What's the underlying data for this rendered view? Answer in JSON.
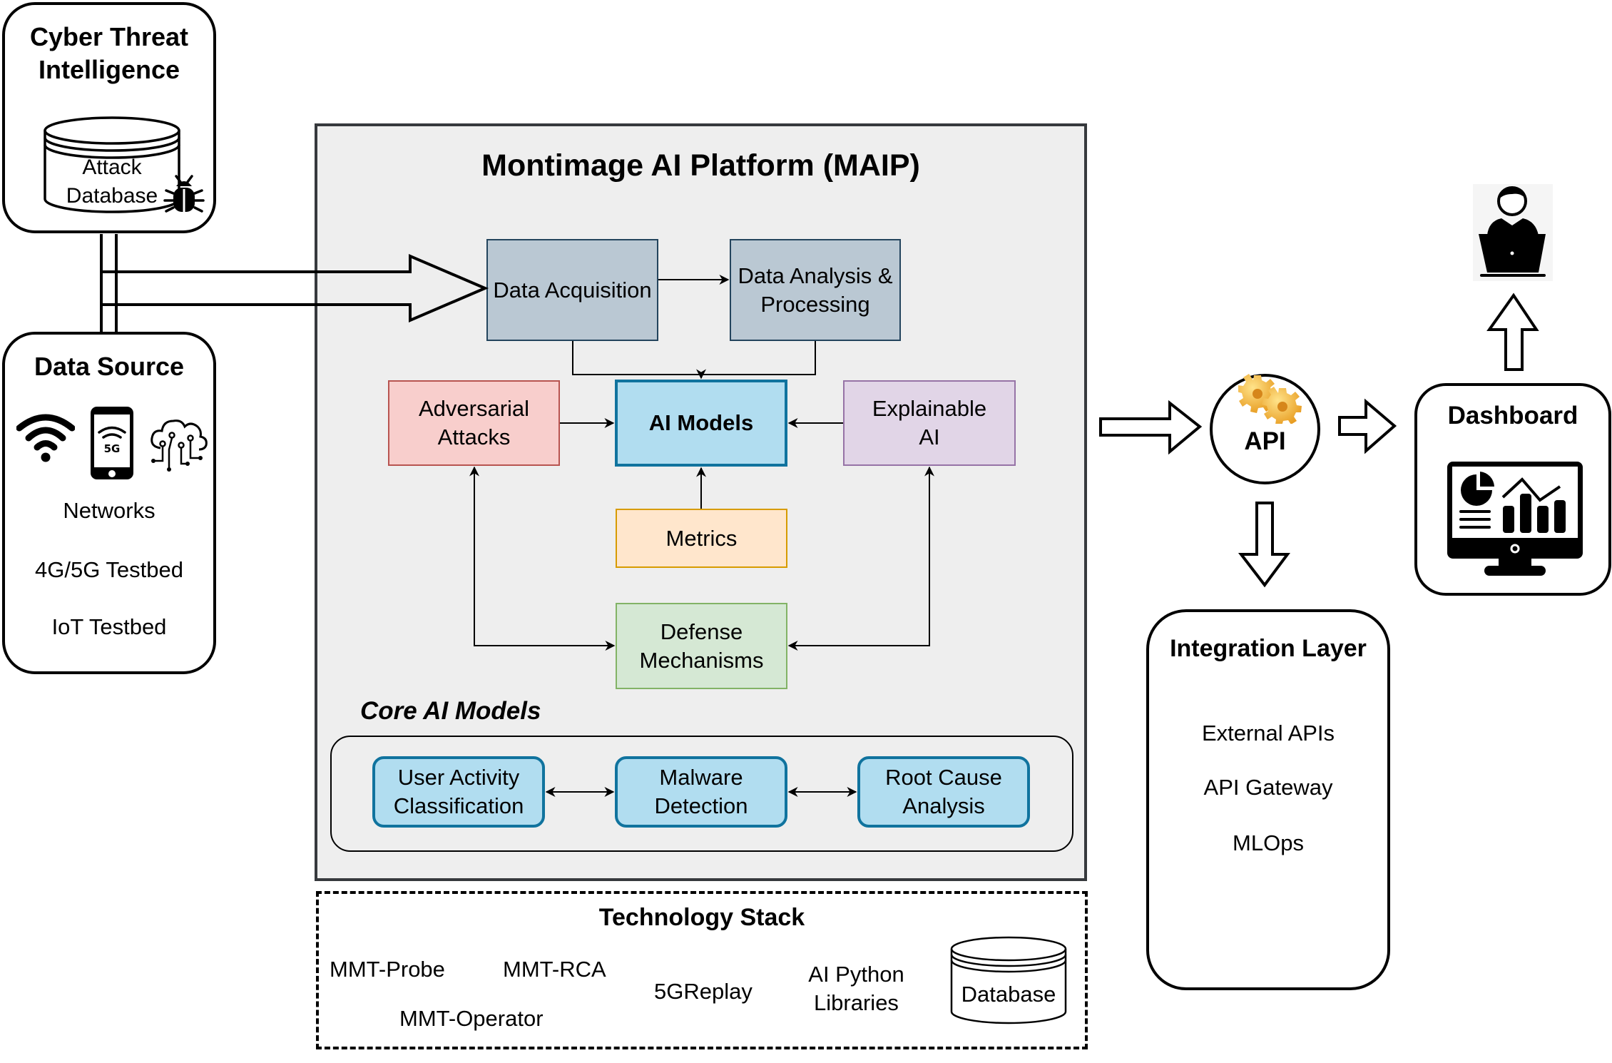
{
  "cti": {
    "title_line1": "Cyber Threat",
    "title_line2": "Intelligence",
    "db_line1": "Attack",
    "db_line2": "Database",
    "icon": "bug-icon"
  },
  "data_source": {
    "title": "Data Source",
    "icons": [
      "wifi-icon",
      "5g-phone-icon",
      "iot-cloud-icon"
    ],
    "phone_badge": "5G",
    "items": [
      "Networks",
      "4G/5G Testbed",
      "IoT Testbed"
    ]
  },
  "maip": {
    "title": "Montimage AI Platform (MAIP)",
    "nodes": {
      "data_acquisition": "Data Acquisition",
      "data_analysis_l1": "Data Analysis &",
      "data_analysis_l2": "Processing",
      "adversarial_l1": "Adversarial",
      "adversarial_l2": "Attacks",
      "ai_models": "AI Models",
      "explainable_l1": "Explainable",
      "explainable_l2": "AI",
      "metrics": "Metrics",
      "defense_l1": "Defense",
      "defense_l2": "Mechanisms"
    },
    "core_title": "Core AI Models",
    "core_models": [
      {
        "l1": "User Activity",
        "l2": "Classification"
      },
      {
        "l1": "Malware",
        "l2": "Detection"
      },
      {
        "l1": "Root Cause",
        "l2": "Analysis"
      }
    ]
  },
  "tech_stack": {
    "title": "Technology Stack",
    "items": {
      "probe": "MMT-Probe",
      "rca": "MMT-RCA",
      "operator": "MMT-Operator",
      "replay": "5GReplay",
      "ai_l1": "AI Python",
      "ai_l2": "Libraries",
      "database": "Database"
    }
  },
  "api": {
    "label": "API",
    "icon": "gears-icon",
    "gear_color": "#f2b33d"
  },
  "integration": {
    "title": "Integration Layer",
    "items": [
      "External APIs",
      "API Gateway",
      "MLOps"
    ]
  },
  "dashboard": {
    "title": "Dashboard",
    "icon": "monitor-analytics-icon"
  },
  "user": {
    "icon": "user-laptop-icon"
  },
  "colors": {
    "maip_fill": "#eeeeee",
    "maip_stroke": "#36393d",
    "steel_fill": "#bac8d3",
    "blue_fill": "#b1ddf0",
    "blue_stroke": "#10739e",
    "red_fill": "#f8cecc",
    "purple_fill": "#e1d5e7",
    "orange_fill": "#ffe6cc",
    "green_fill": "#d5e8d4"
  }
}
